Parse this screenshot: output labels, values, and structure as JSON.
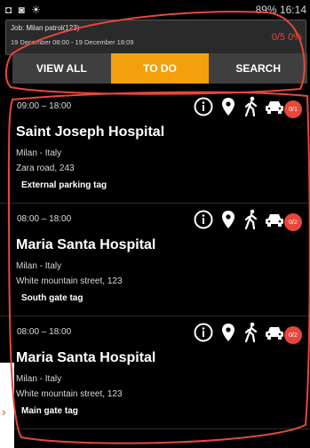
{
  "status_bar": {
    "left_icons": "◘ ◙ ☀",
    "right": "89% 16:14"
  },
  "job": {
    "line1": "Job: Milan patrol(123)",
    "line2": "19 December 08:00 - 19 December 18:09",
    "progress": "0/5 0%"
  },
  "tabs": [
    {
      "label": "VIEW ALL"
    },
    {
      "label": "TO DO"
    },
    {
      "label": "SEARCH"
    }
  ],
  "active_tab": "TO DO",
  "cards": [
    {
      "time": "09:00 – 18:00",
      "title": "Saint Joseph Hospital",
      "city": "Milan - Italy",
      "address": "Zara road, 243",
      "tag": "External parking tag",
      "badge": "0/1"
    },
    {
      "time": "08:00 – 18:00",
      "title": "Maria Santa Hospital",
      "city": "Milan - Italy",
      "address": "White mountain street, 123",
      "tag": "South gate tag",
      "badge": "0/2"
    },
    {
      "time": "08:00 – 18:00",
      "title": "Maria Santa Hospital",
      "city": "Milan - Italy",
      "address": "White mountain street, 123",
      "tag": "Main gate tag",
      "badge": "0/2"
    }
  ],
  "icon_names": [
    "info-icon",
    "location-pin-icon",
    "walking-person-icon",
    "car-icon"
  ],
  "colors": {
    "accent": "#f3a00c",
    "badge_red": "#e7473b",
    "annotation_red": "#e7473b"
  }
}
